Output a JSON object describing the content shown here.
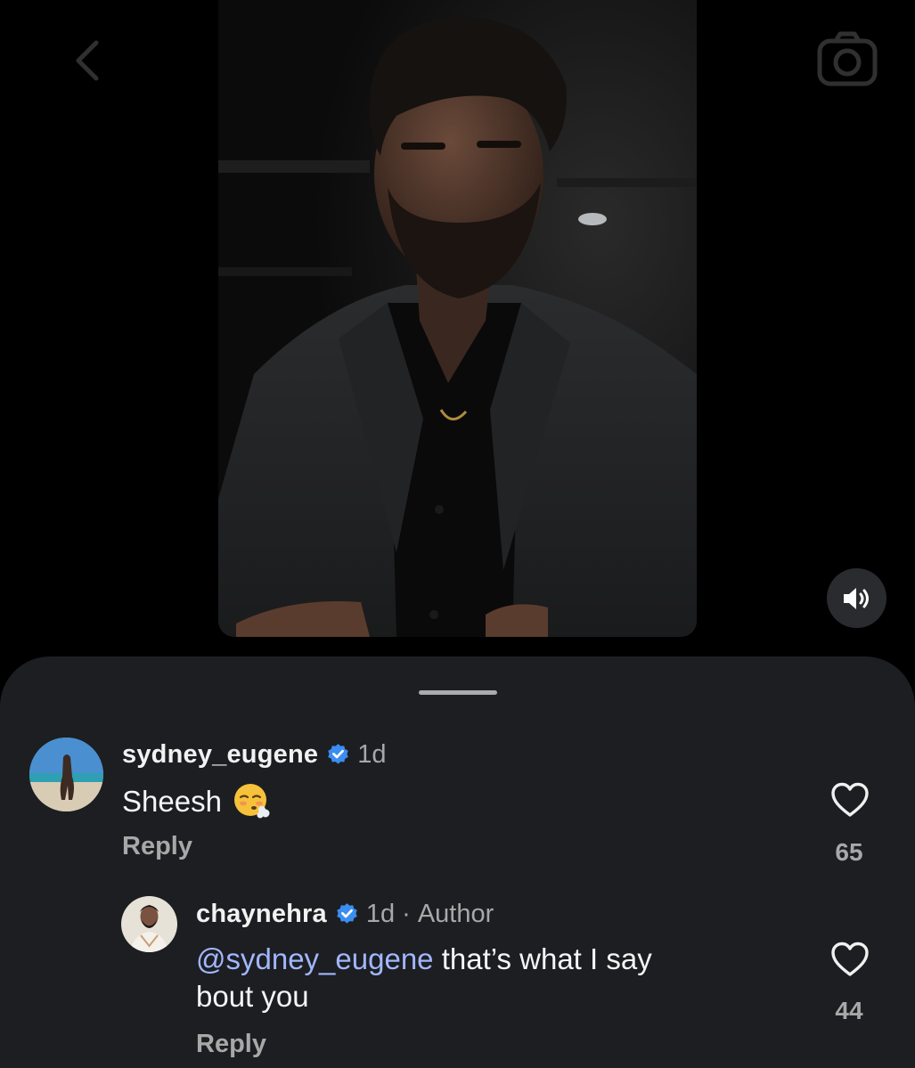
{
  "nav": {
    "back_icon": "chevron-left-icon",
    "camera_icon": "camera-icon"
  },
  "media": {
    "sound_icon": "speaker-icon"
  },
  "comments": [
    {
      "username": "sydney_eugene",
      "time": "1d",
      "badge": "",
      "text": "Sheesh",
      "emoji": "face-exhaling-icon",
      "reply_label": "Reply",
      "likes": "65"
    },
    {
      "username": "chaynehra",
      "time": "1d",
      "separator": "·",
      "badge": "Author",
      "mention": "@sydney_eugene",
      "text_line1": " that’s what I say",
      "text_line2": "bout you",
      "reply_label": "Reply",
      "likes": "44"
    }
  ],
  "colors": {
    "sheet_bg": "#1c1e21",
    "mention": "#a2b6ff",
    "verified": "#3b8df0",
    "muted": "#a8a8a8"
  }
}
